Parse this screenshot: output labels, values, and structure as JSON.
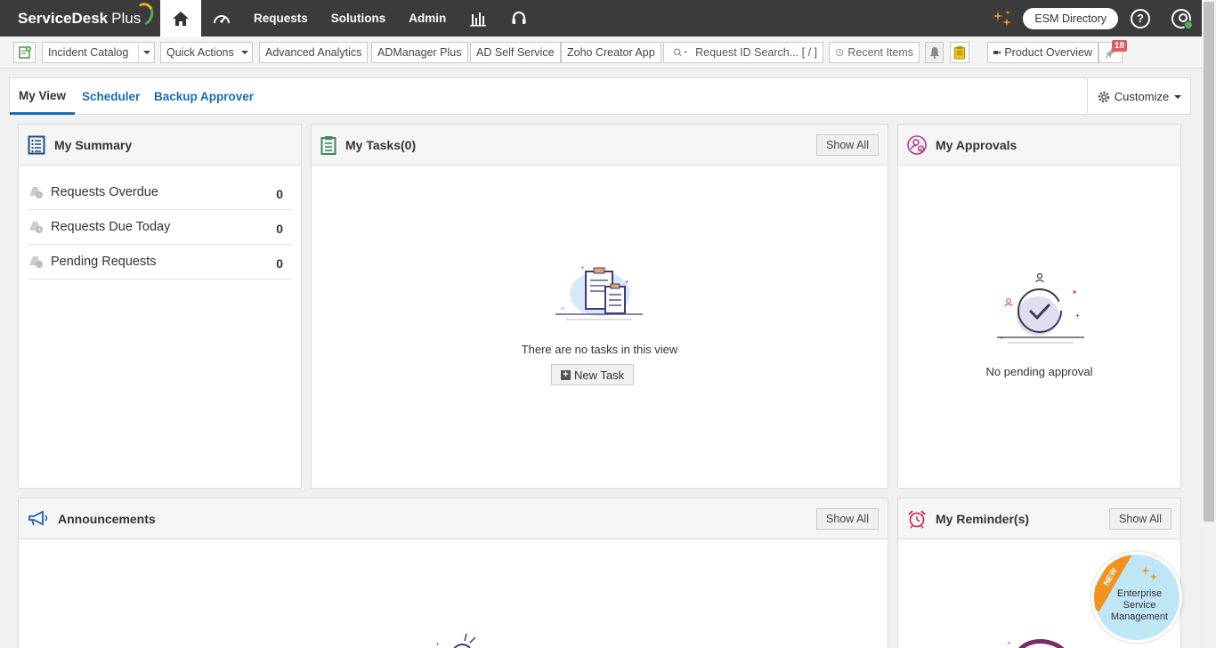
{
  "app": {
    "brand_name": "ServiceDesk",
    "brand_suffix": "Plus"
  },
  "topnav": {
    "items": [
      "Requests",
      "Solutions",
      "Admin"
    ],
    "esm_directory": "ESM Directory",
    "help": "?"
  },
  "toolbar": {
    "incident_catalog": "Incident Catalog",
    "quick_actions": "Quick Actions",
    "advanced_analytics": "Advanced Analytics",
    "admanager": "ADManager Plus",
    "ad_self_service": "AD Self Service",
    "zoho_creator": "Zoho Creator App",
    "search_placeholder": "Request ID Search... [ / ]",
    "recent_items": "Recent Items",
    "product_overview": "Product Overview",
    "badge_count": "18"
  },
  "tabs": [
    {
      "label": "My View",
      "active": true
    },
    {
      "label": "Scheduler",
      "active": false
    },
    {
      "label": "Backup Approver",
      "active": false
    }
  ],
  "customize": "Customize",
  "summary": {
    "title": "My Summary",
    "rows": [
      {
        "label": "Requests Overdue",
        "count": "0"
      },
      {
        "label": "Requests Due Today",
        "count": "0"
      },
      {
        "label": "Pending Requests",
        "count": "0"
      }
    ]
  },
  "tasks": {
    "title": "My Tasks(0)",
    "show_all": "Show All",
    "empty_text": "There are no tasks in this view",
    "new_task": "New Task"
  },
  "approvals": {
    "title": "My Approvals",
    "empty_text": "No pending approval"
  },
  "announcements": {
    "title": "Announcements",
    "show_all": "Show All"
  },
  "reminders": {
    "title": "My Reminder(s)",
    "show_all": "Show All"
  },
  "esm_promo": {
    "ribbon": "NEW",
    "text": "Enterprise Service Management"
  },
  "colors": {
    "nav_bg": "#3b3b3b",
    "accent": "#1a6db5",
    "badge": "#e25b5b"
  }
}
